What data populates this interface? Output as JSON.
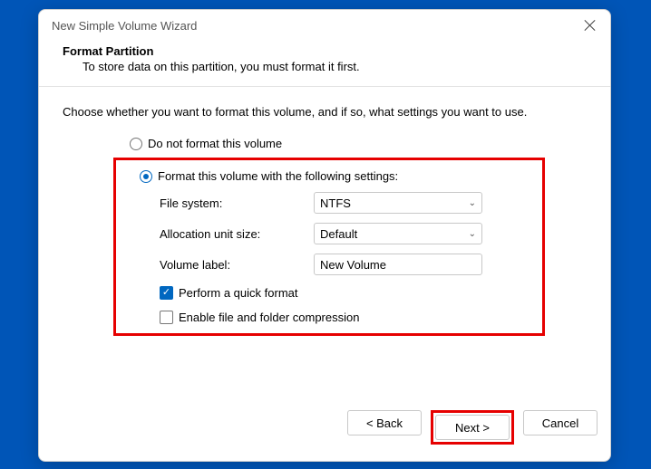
{
  "window": {
    "title": "New Simple Volume Wizard"
  },
  "header": {
    "title": "Format Partition",
    "description": "To store data on this partition, you must format it first."
  },
  "body": {
    "instruction": "Choose whether you want to format this volume, and if so, what settings you want to use.",
    "option_no_format": "Do not format this volume",
    "option_format": "Format this volume with the following settings:",
    "selected_option": "format",
    "labels": {
      "file_system": "File system:",
      "allocation": "Allocation unit size:",
      "volume_label": "Volume label:"
    },
    "values": {
      "file_system": "NTFS",
      "allocation": "Default",
      "volume_label": "New Volume"
    },
    "checkboxes": {
      "quick_format_label": "Perform a quick format",
      "quick_format_checked": true,
      "compression_label": "Enable file and folder compression",
      "compression_checked": false
    }
  },
  "footer": {
    "back": "< Back",
    "next": "Next >",
    "cancel": "Cancel"
  }
}
